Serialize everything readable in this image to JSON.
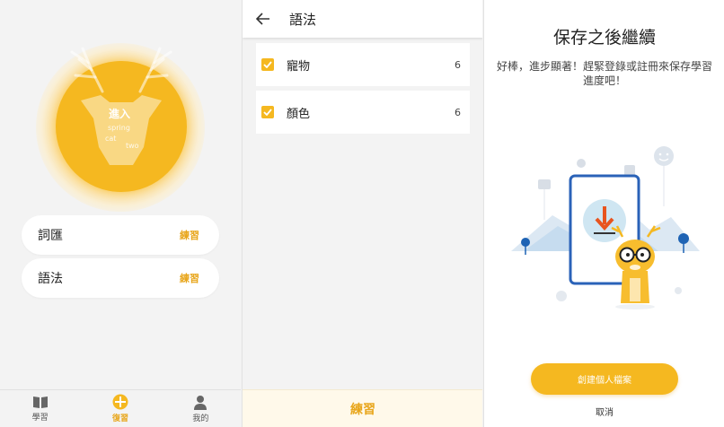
{
  "review": {
    "medal": {
      "main_word": "進入",
      "words": [
        "spring",
        "cat",
        "two"
      ]
    },
    "cards": [
      {
        "title": "詞匯",
        "action": "練習"
      },
      {
        "title": "語法",
        "action": "練習"
      }
    ],
    "tabs": [
      {
        "label": "學習",
        "icon": "book-icon",
        "active": false
      },
      {
        "label": "復習",
        "icon": "review-icon",
        "active": true
      },
      {
        "label": "我的",
        "icon": "person-icon",
        "active": false
      }
    ],
    "accent_color": "#f5b820"
  },
  "grammar": {
    "title": "語法",
    "items": [
      {
        "label": "寵物",
        "count": "6",
        "checked": true
      },
      {
        "label": "顏色",
        "count": "6",
        "checked": true
      }
    ],
    "practice_label": "練習"
  },
  "save": {
    "title": "保存之後繼續",
    "subtitle": "好棒，進步顯著！趕緊登錄或註冊來保存學習進度吧！",
    "create_label": "創建個人檔案",
    "cancel_label": "取消"
  }
}
